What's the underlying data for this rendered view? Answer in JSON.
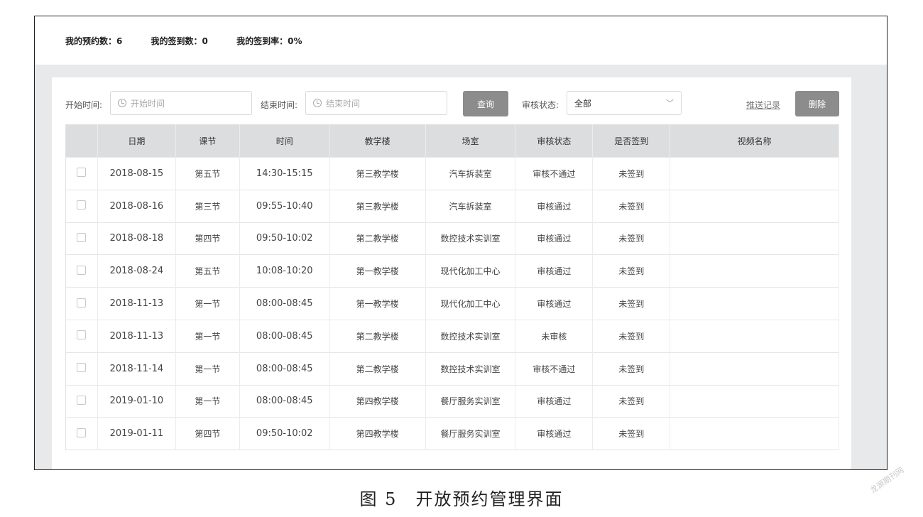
{
  "stats": {
    "reservations": "我的预约数：6",
    "signins": "我的签到数：0",
    "signin_rate": "我的签到率：0%"
  },
  "filters": {
    "start_label": "开始时间:",
    "start_placeholder": "开始时间",
    "end_label": "结束时间:",
    "end_placeholder": "结束时间",
    "query_button": "查询",
    "status_label": "审核状态:",
    "status_value": "全部",
    "push_record_link": "推送记录",
    "delete_button": "删除"
  },
  "table": {
    "headers": [
      "",
      "日期",
      "课节",
      "时间",
      "教学楼",
      "场室",
      "审核状态",
      "是否签到",
      "视频名称"
    ],
    "rows": [
      [
        "2018-08-15",
        "第五节",
        "14:30-15:15",
        "第三教学楼",
        "汽车拆装室",
        "审核不通过",
        "未签到",
        ""
      ],
      [
        "2018-08-16",
        "第三节",
        "09:55-10:40",
        "第三教学楼",
        "汽车拆装室",
        "审核通过",
        "未签到",
        ""
      ],
      [
        "2018-08-18",
        "第四节",
        "09:50-10:02",
        "第二教学楼",
        "数控技术实训室",
        "审核通过",
        "未签到",
        ""
      ],
      [
        "2018-08-24",
        "第五节",
        "10:08-10:20",
        "第一教学楼",
        "现代化加工中心",
        "审核通过",
        "未签到",
        ""
      ],
      [
        "2018-11-13",
        "第一节",
        "08:00-08:45",
        "第一教学楼",
        "现代化加工中心",
        "审核通过",
        "未签到",
        ""
      ],
      [
        "2018-11-13",
        "第一节",
        "08:00-08:45",
        "第二教学楼",
        "数控技术实训室",
        "未审核",
        "未签到",
        ""
      ],
      [
        "2018-11-14",
        "第一节",
        "08:00-08:45",
        "第二教学楼",
        "数控技术实训室",
        "审核不通过",
        "未签到",
        ""
      ],
      [
        "2019-01-10",
        "第一节",
        "08:00-08:45",
        "第四教学楼",
        "餐厅服务实训室",
        "审核通过",
        "未签到",
        ""
      ],
      [
        "2019-01-11",
        "第四节",
        "09:50-10:02",
        "第四教学楼",
        "餐厅服务实训室",
        "审核通过",
        "未签到",
        ""
      ]
    ]
  },
  "caption": "图 5　开放预约管理界面",
  "watermark": "龙源期刊网"
}
